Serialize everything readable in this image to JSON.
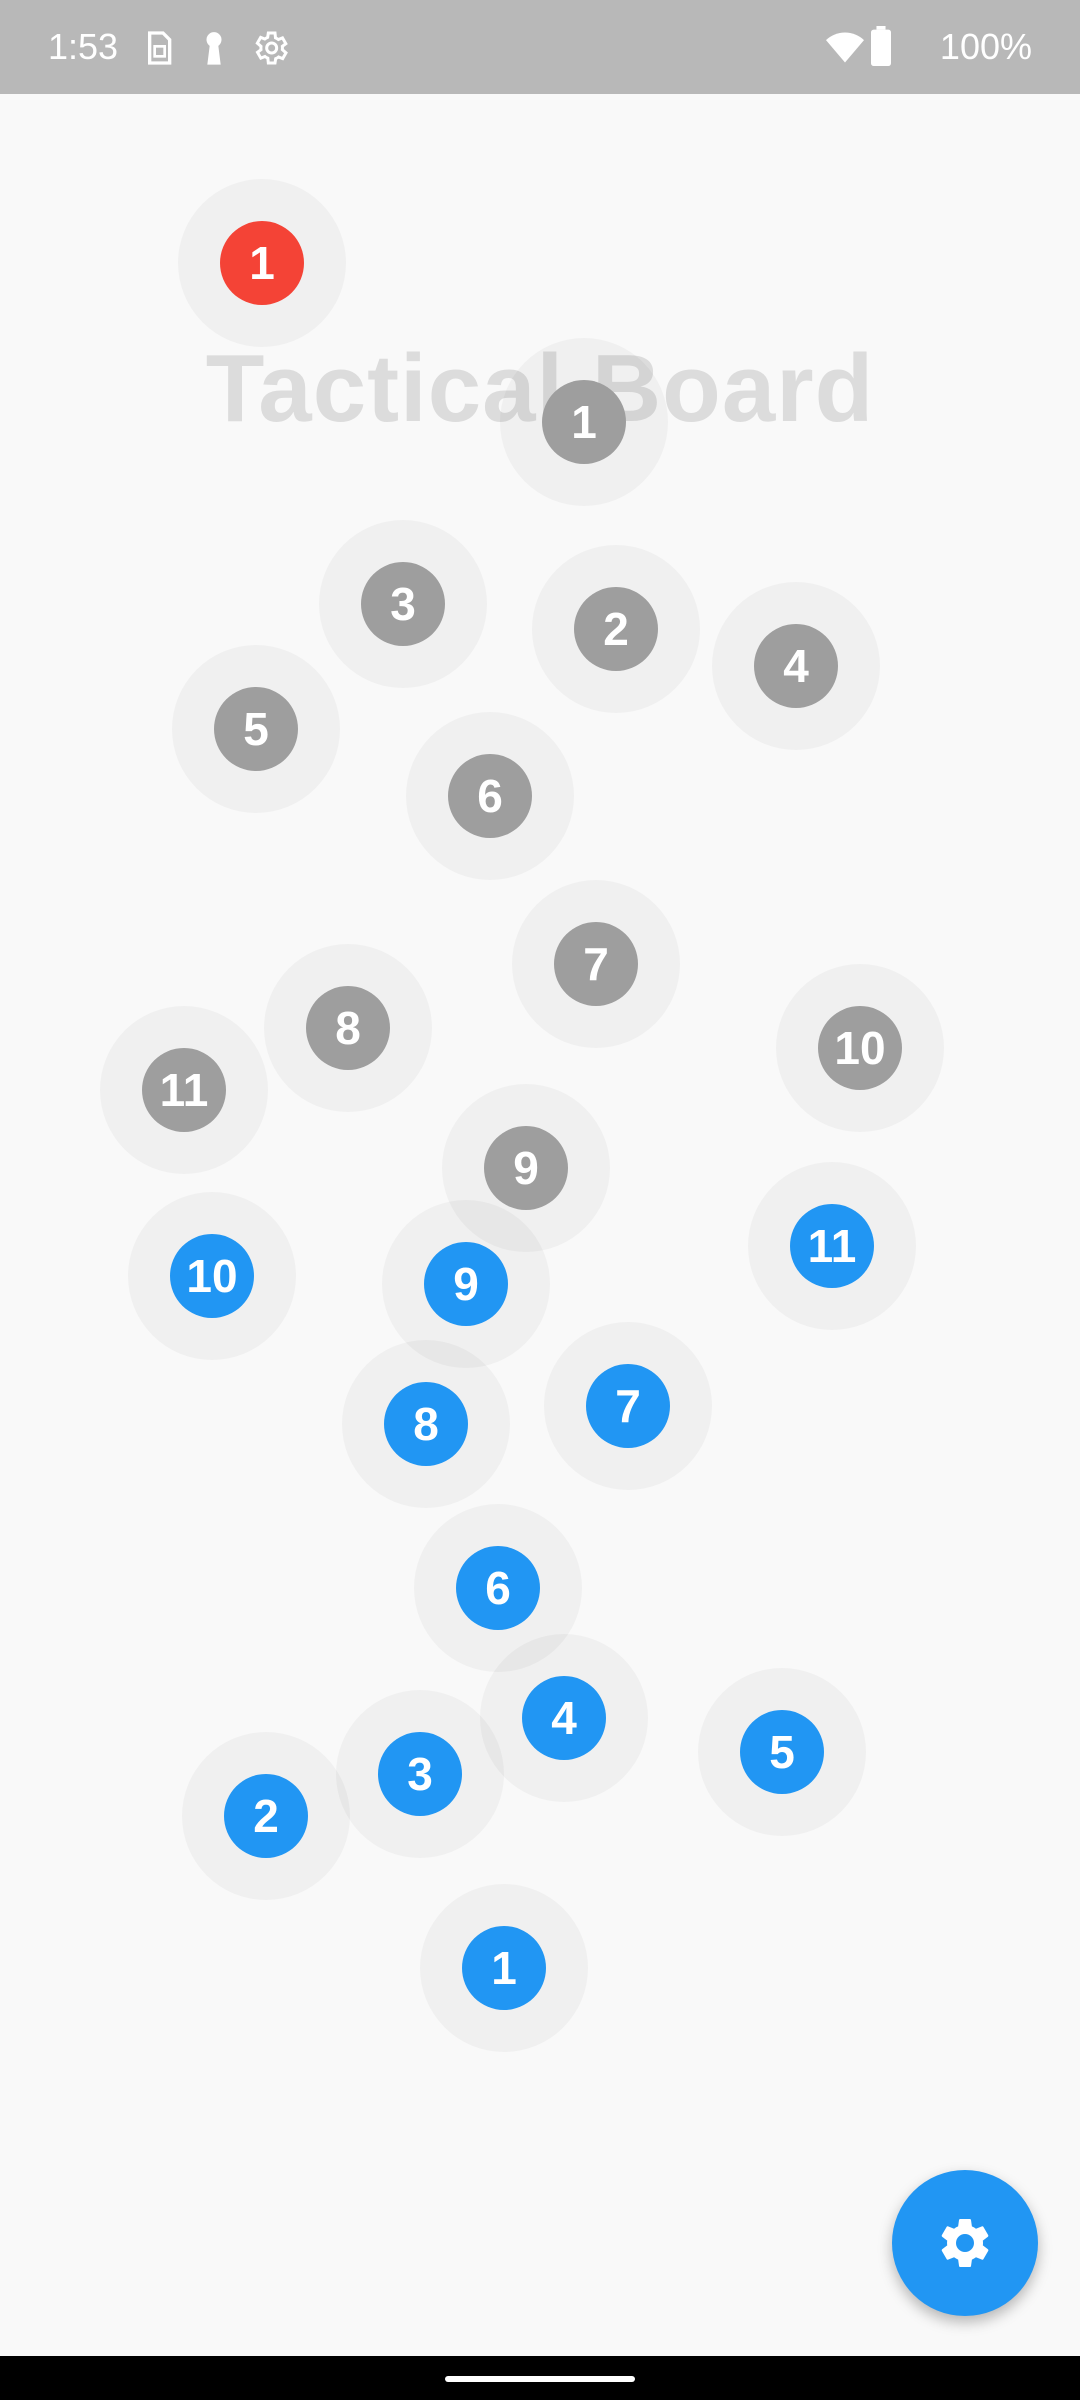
{
  "status_bar": {
    "time": "1:53",
    "battery": "100%",
    "left_icons": [
      "sim-icon",
      "key-icon",
      "settings-gear-icon"
    ],
    "right_icons": [
      "wifi-icon",
      "battery-icon"
    ]
  },
  "board": {
    "title": "Tactical Board",
    "background": "#f9f9f9",
    "ball": {
      "label": "1",
      "color": "#f44336"
    },
    "team_grey": {
      "color": "#9e9e9e",
      "players": [
        "1",
        "2",
        "3",
        "4",
        "5",
        "6",
        "7",
        "8",
        "9",
        "10",
        "11"
      ]
    },
    "team_blue": {
      "color": "#2196f3",
      "players": [
        "1",
        "2",
        "3",
        "4",
        "5",
        "6",
        "7",
        "8",
        "9",
        "10",
        "11"
      ]
    }
  },
  "fab": {
    "icon": "settings-gear-icon",
    "color": "#2196f3"
  }
}
